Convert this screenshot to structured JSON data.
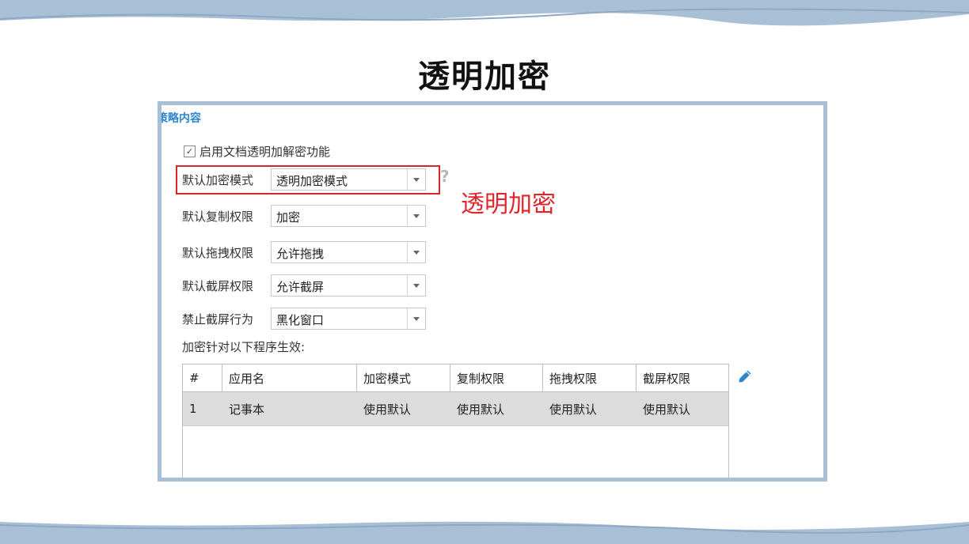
{
  "slide": {
    "title": "透明加密"
  },
  "panel": {
    "section_title": "策略内容",
    "enable_checkbox": {
      "checked": true,
      "label": "启用文档透明加解密功能"
    },
    "fields": [
      {
        "label": "默认加密模式",
        "value": "透明加密模式"
      },
      {
        "label": "默认复制权限",
        "value": "加密"
      },
      {
        "label": "默认拖拽权限",
        "value": "允许拖拽"
      },
      {
        "label": "默认截屏权限",
        "value": "允许截屏"
      },
      {
        "label": "禁止截屏行为",
        "value": "黑化窗口"
      }
    ],
    "help_icon": "question-mark-icon",
    "annotation": "透明加密",
    "table_caption": "加密针对以下程序生效:",
    "table": {
      "headers": [
        "#",
        "应用名",
        "加密模式",
        "复制权限",
        "拖拽权限",
        "截屏权限"
      ],
      "rows": [
        [
          "1",
          "记事本",
          "使用默认",
          "使用默认",
          "使用默认",
          "使用默认"
        ]
      ]
    },
    "edit_icon": "pencil-icon"
  },
  "colors": {
    "band": "#a9bfd6",
    "accent": "#2f86cc",
    "highlight": "#d9262c"
  }
}
